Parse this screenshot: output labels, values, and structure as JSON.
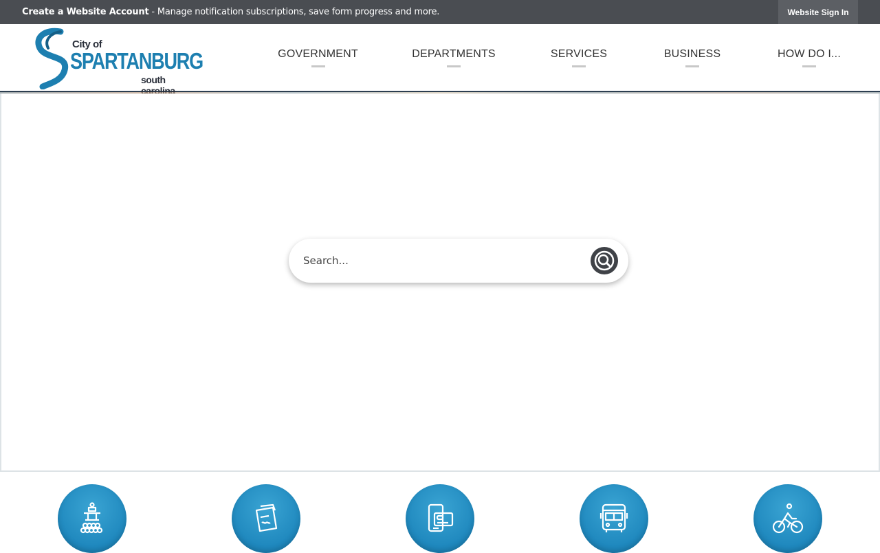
{
  "topbar": {
    "create_strong": "Create a Website Account",
    "create_rest": " - Manage notification subscriptions, save form progress and more.",
    "signin_label": "Website Sign In"
  },
  "logo": {
    "city_of": "City of",
    "name": "SPARTANBURG",
    "state": "south carolina"
  },
  "nav": {
    "items": [
      {
        "label": "GOVERNMENT"
      },
      {
        "label": "DEPARTMENTS"
      },
      {
        "label": "SERVICES"
      },
      {
        "label": "BUSINESS"
      },
      {
        "label": "HOW DO I..."
      }
    ]
  },
  "search": {
    "placeholder": "Search..."
  },
  "quick_links": [
    {
      "icon": "fountain-icon"
    },
    {
      "icon": "notepad-icon"
    },
    {
      "icon": "mobile-payment-icon"
    },
    {
      "icon": "bus-icon"
    },
    {
      "icon": "cyclist-icon"
    }
  ],
  "colors": {
    "topbar": "#4a4d52",
    "brand_blue": "#1d7fb0",
    "search_button": "#3f4247",
    "quick_link_blue": "#1e87bd"
  }
}
